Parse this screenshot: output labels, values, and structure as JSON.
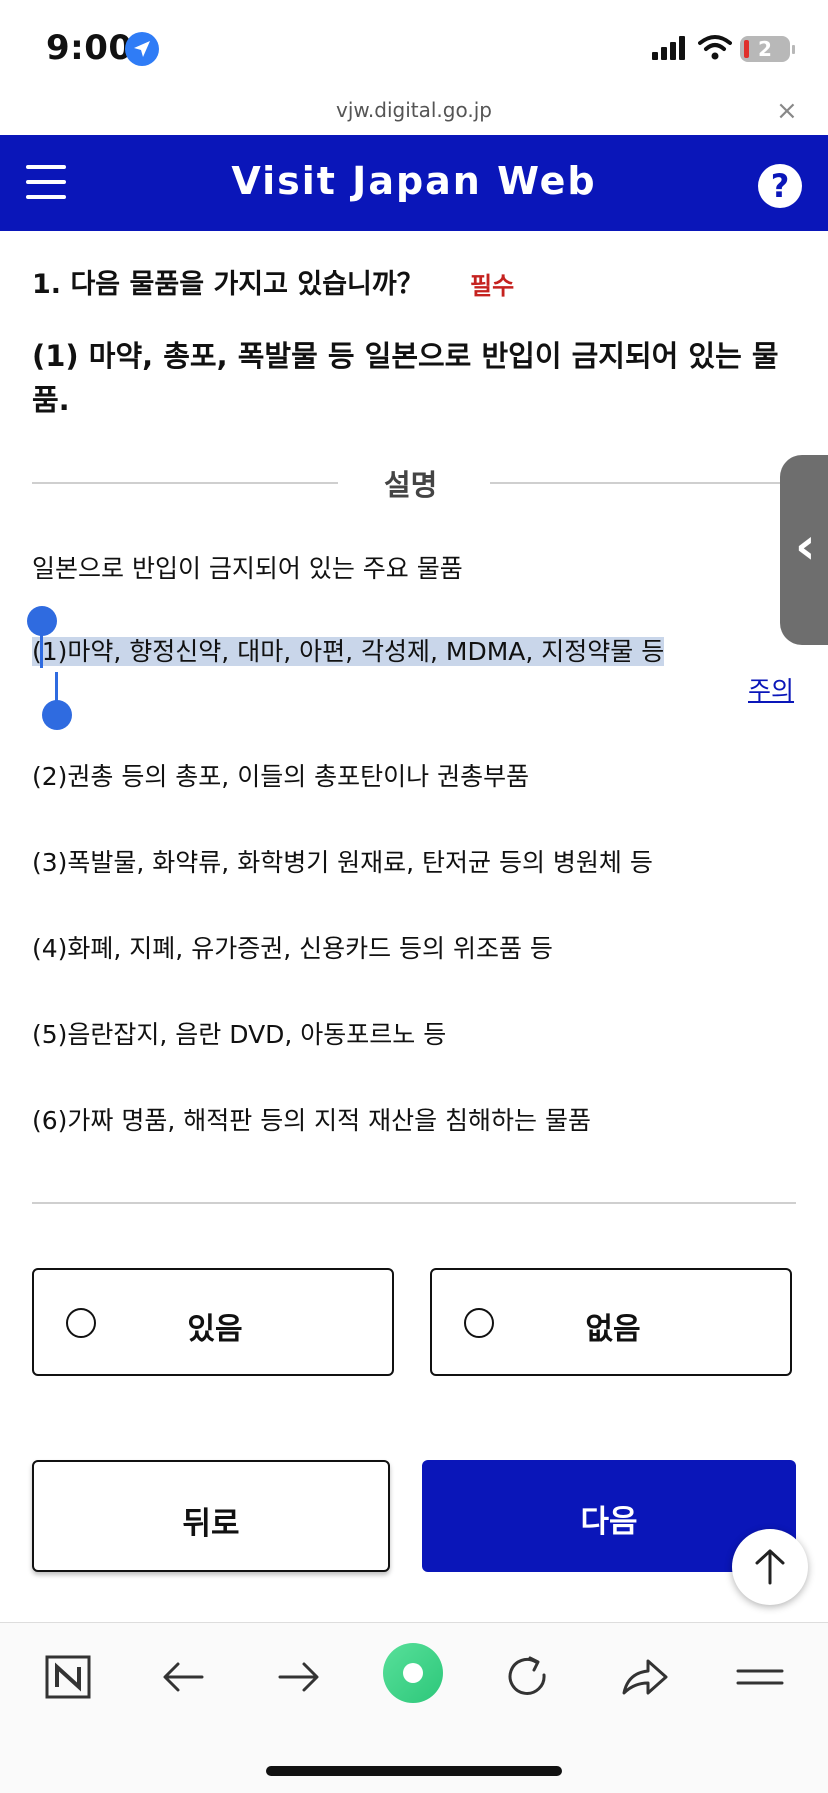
{
  "status_bar": {
    "time": "9:00",
    "battery": "2"
  },
  "browser": {
    "url": "vjw.digital.go.jp",
    "close_glyph": "×"
  },
  "header": {
    "title": "Visit Japan Web",
    "help_glyph": "?"
  },
  "question": {
    "title": "1. 다음 물품을 가지고 있습니까？",
    "required": "필수",
    "subtitle": "(1) 마약, 총포, 폭발물 등 일본으로 반입이 금지되어 있는 물품."
  },
  "explanation": {
    "heading": "설명",
    "intro": "일본으로 반입이 금지되어 있는 주요 물품",
    "items": [
      "(1)마약, 향정신약, 대마, 아편, 각성제, MDMA, 지정약물 등",
      "(2)권총 등의 총포, 이들의 총포탄이나 권총부품",
      "(3)폭발물, 화약류, 화학병기 원재료, 탄저균 등의 병원체 등",
      "(4)화폐, 지폐, 유가증권, 신용카드 등의 위조품 등",
      "(5)음란잡지, 음란 DVD, 아동포르노 등",
      "(6)가짜 명품, 해적판 등의 지적 재산을 침해하는 물품"
    ],
    "note_link": "주의"
  },
  "options": {
    "yes": "있음",
    "no": "없음"
  },
  "buttons": {
    "back": "뒤로",
    "next": "다음"
  },
  "icons": {
    "side_tab": "chevron-left-icon",
    "scroll_top": "arrow-up-icon",
    "nav": [
      "naver-icon",
      "back-arrow-icon",
      "forward-arrow-icon",
      "green-dot-icon",
      "refresh-icon",
      "share-icon",
      "menu-icon"
    ]
  },
  "colors": {
    "brand": "#0a16b9",
    "required": "#c5221f",
    "selection": "#c9d6ea",
    "handle": "#2f6be0"
  }
}
